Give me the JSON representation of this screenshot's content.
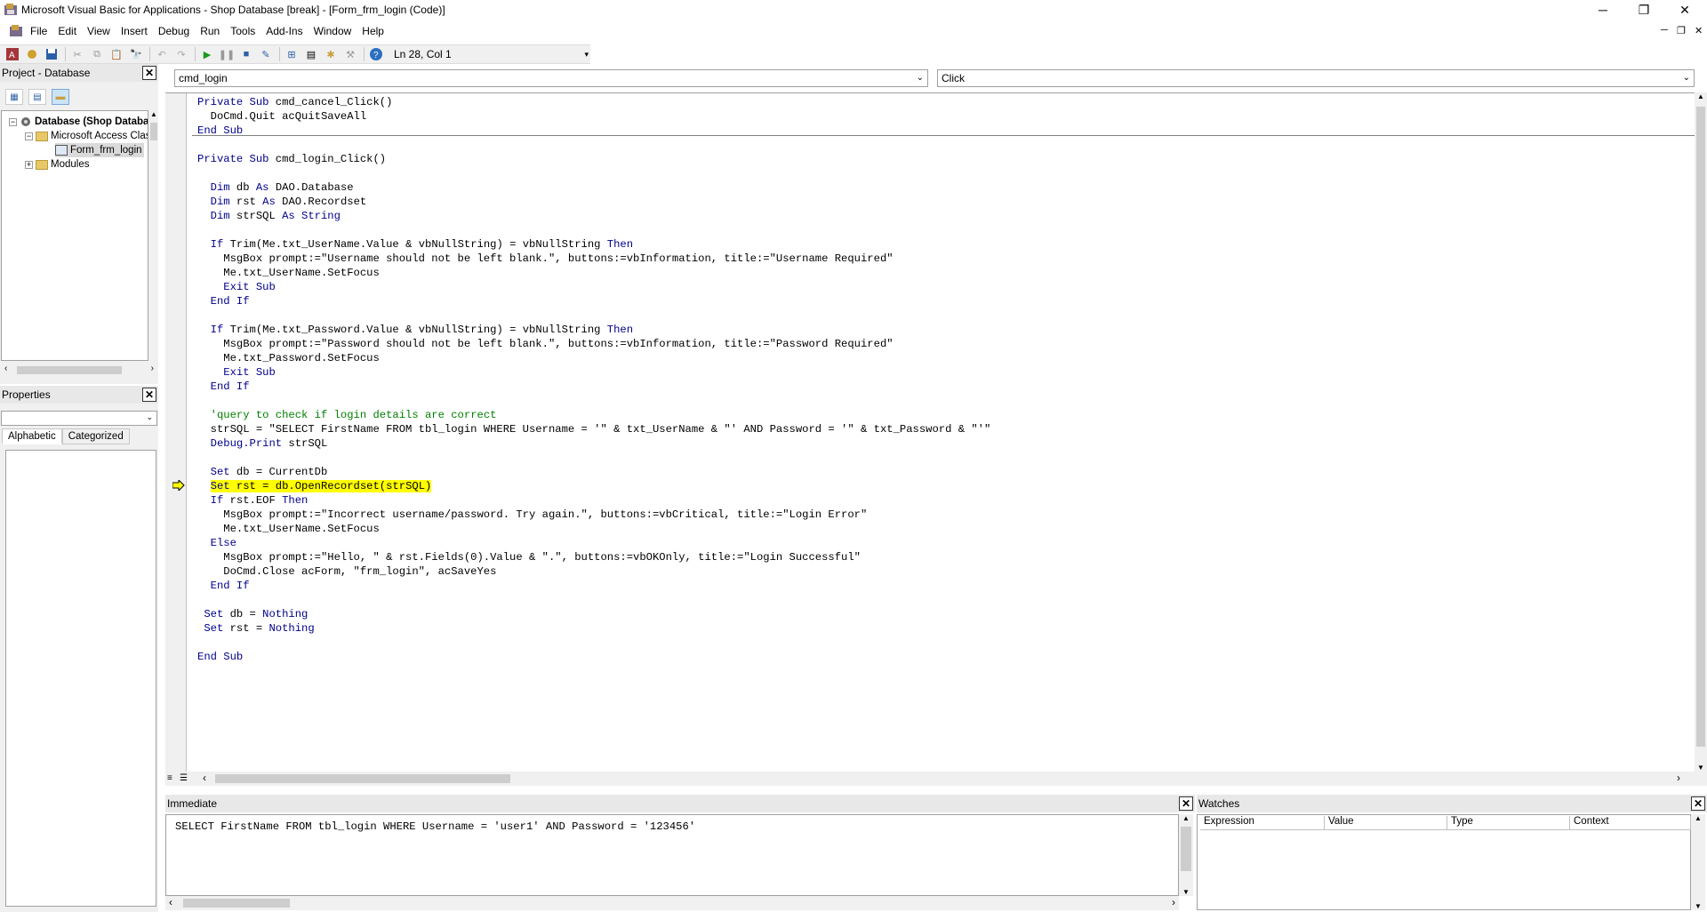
{
  "window": {
    "title": "Microsoft Visual Basic for Applications - Shop Database [break] - [Form_frm_login (Code)]",
    "controls": {
      "minimize": "─",
      "restore": "❐",
      "close": "✕"
    }
  },
  "menubar": {
    "items": [
      "File",
      "Edit",
      "View",
      "Insert",
      "Debug",
      "Run",
      "Tools",
      "Add-Ins",
      "Window",
      "Help"
    ]
  },
  "toolbar": {
    "position": "Ln 28, Col 1"
  },
  "project_panel": {
    "title": "Project - Database",
    "tree": {
      "root": "Database (Shop Database)",
      "class_objects": "Microsoft Access Class O",
      "form": "Form_frm_login",
      "modules": "Modules"
    }
  },
  "properties_panel": {
    "title": "Properties",
    "tabs": [
      "Alphabetic",
      "Categorized"
    ]
  },
  "code_window": {
    "object_combo": "cmd_login",
    "procedure_combo": "Click"
  },
  "immediate": {
    "title": "Immediate",
    "output": "SELECT FirstName FROM tbl_login WHERE Username = 'user1' AND Password = '123456'"
  },
  "watches": {
    "title": "Watches",
    "columns": [
      "Expression",
      "Value",
      "Type",
      "Context"
    ]
  },
  "colors": {
    "keyword": "#00008b",
    "comment": "#008000",
    "current_line_highlight": "#ffff00"
  }
}
